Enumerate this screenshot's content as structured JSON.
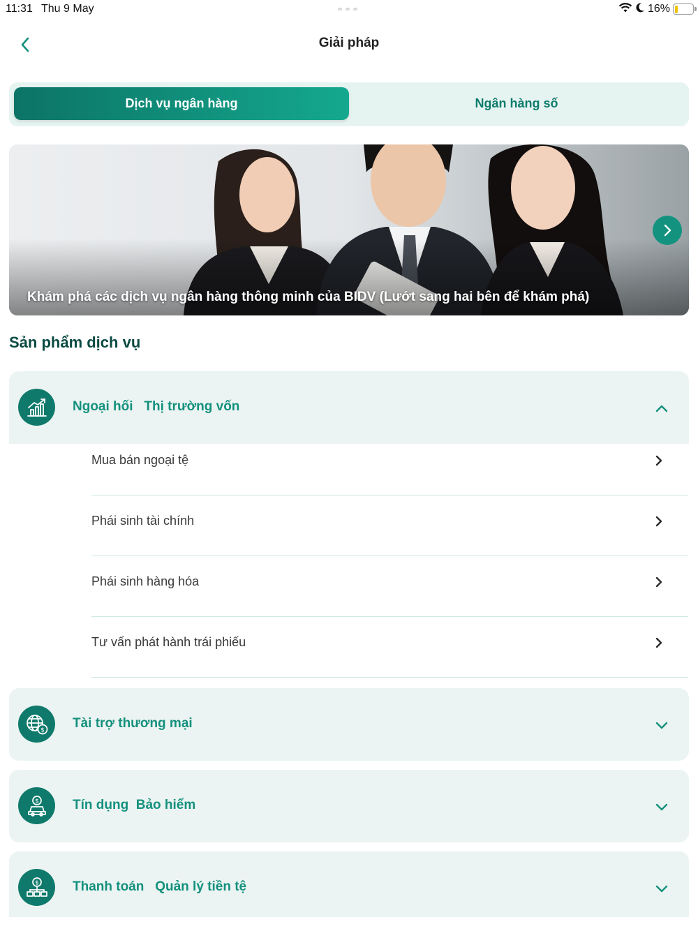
{
  "status_bar": {
    "time": "11:31",
    "date": "Thu 9 May",
    "battery": "16%",
    "battery_level": 0.16
  },
  "header": {
    "title": "Giải pháp",
    "back_icon": "chevron-left-icon"
  },
  "tabs": [
    {
      "label": "Dịch vụ ngân hàng",
      "active": true
    },
    {
      "label": "Ngân hàng số",
      "active": false
    }
  ],
  "banner": {
    "caption": "Khám phá các dịch vụ ngân hàng thông minh của BIDV (Lướt sang hai bên để khám phá)",
    "next_icon": "chevron-right-icon"
  },
  "section": {
    "title": "Sản phẩm dịch vụ"
  },
  "categories": [
    {
      "title": "Ngoại hối   Thị trường vốn",
      "icon": "chart-growth-icon",
      "expanded": true,
      "items": [
        {
          "label": "Mua bán ngoại tệ"
        },
        {
          "label": "Phái sinh tài chính"
        },
        {
          "label": "Phái sinh hàng hóa"
        },
        {
          "label": "Tư vấn phát hành trái phiếu"
        }
      ]
    },
    {
      "title": "Tài trợ thương mại",
      "icon": "globe-dollar-icon",
      "expanded": false
    },
    {
      "title": "Tín dụng  Bảo hiểm",
      "icon": "car-dollar-icon",
      "expanded": false
    },
    {
      "title": "Thanh toán   Quản lý tiền tệ",
      "icon": "money-network-icon",
      "expanded": false
    }
  ],
  "colors": {
    "accent": "#14907d",
    "tab_active_start": "#0c7466",
    "tab_active_end": "#14a88f",
    "card_bg": "#ebf4f2",
    "section_title": "#0a4a42"
  }
}
